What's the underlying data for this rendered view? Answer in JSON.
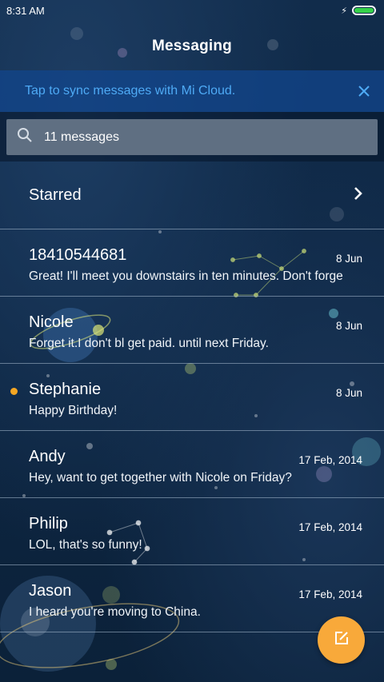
{
  "status_bar": {
    "time": "8:31 AM",
    "charging_icon": "bolt-icon",
    "battery_color": "#35d24a"
  },
  "header": {
    "title": "Messaging"
  },
  "sync_banner": {
    "text": "Tap to sync messages with Mi Cloud.",
    "close_icon": "close-icon",
    "text_color": "#4eaaf5"
  },
  "search": {
    "text": "11 messages",
    "icon": "search-icon"
  },
  "starred": {
    "label": "Starred",
    "icon": "chevron-right-icon"
  },
  "conversations": [
    {
      "name": "18410544681",
      "date": "8 Jun",
      "preview": "Great! I'll meet you downstairs in ten minutes. Don't forge",
      "unread": false
    },
    {
      "name": "Nicole",
      "date": "8 Jun",
      "preview": "Forget it.I don't bl get paid. until next Friday.",
      "unread": false
    },
    {
      "name": "Stephanie",
      "date": "8 Jun",
      "preview": "Happy Birthday!",
      "unread": true
    },
    {
      "name": "Andy",
      "date": "17 Feb, 2014",
      "preview": "Hey, want to get together with Nicole on Friday?",
      "unread": false
    },
    {
      "name": "Philip",
      "date": "17 Feb, 2014",
      "preview": "LOL, that's so funny!",
      "unread": false
    },
    {
      "name": "Jason",
      "date": "17 Feb, 2014",
      "preview": "I heard you're moving to China.",
      "unread": false
    }
  ],
  "compose_button": {
    "icon": "compose-icon",
    "color": "#f8a93a"
  },
  "colors": {
    "background": "#0d2540",
    "unread_dot": "#f5a623",
    "accent": "#4eaaf5"
  }
}
